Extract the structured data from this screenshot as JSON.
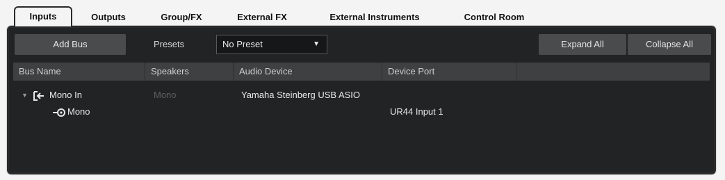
{
  "tabs": [
    {
      "label": "Inputs"
    },
    {
      "label": "Outputs"
    },
    {
      "label": "Group/FX"
    },
    {
      "label": "External FX"
    },
    {
      "label": "External Instruments"
    },
    {
      "label": "Control Room"
    }
  ],
  "toolbar": {
    "add_bus_label": "Add Bus",
    "presets_label": "Presets",
    "preset_value": "No Preset",
    "expand_all_label": "Expand All",
    "collapse_all_label": "Collapse All"
  },
  "columns": [
    "Bus Name",
    "Speakers",
    "Audio Device",
    "Device Port"
  ],
  "rows": [
    {
      "name": "Mono In",
      "speakers": "Mono",
      "device": "Yamaha Steinberg USB ASIO",
      "port": ""
    },
    {
      "name": "Mono",
      "speakers": "",
      "device": "",
      "port": "UR44 Input 1"
    }
  ],
  "colors": {
    "panel_bg": "#222324",
    "header_bg": "#3f4041",
    "button_bg": "#4a4b4c"
  }
}
